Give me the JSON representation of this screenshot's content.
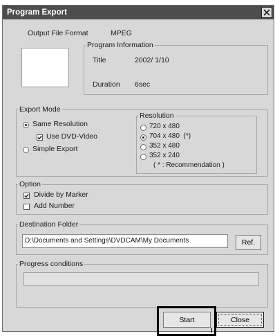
{
  "window": {
    "title": "Program Export"
  },
  "output": {
    "label": "Output File Format",
    "value": "MPEG"
  },
  "program_info": {
    "legend": "Program Information",
    "title_label": "Title",
    "title_value": "2002/ 1/10",
    "duration_label": "Duration",
    "duration_value": "6sec"
  },
  "export_mode": {
    "legend": "Export Mode",
    "same_resolution": "Same Resolution",
    "use_dvd_video": "Use DVD-Video",
    "simple_export": "Simple Export",
    "selected": "Same Resolution",
    "use_dvd_video_checked": true
  },
  "resolution": {
    "legend": "Resolution",
    "options": [
      "720 x 480",
      "704 x 480  (*)",
      "352 x 480",
      "352 x 240"
    ],
    "selected": "704 x 480  (*)",
    "note": "( * : Recommendation )"
  },
  "option": {
    "legend": "Option",
    "divide_by_marker": "Divide by Marker",
    "divide_by_marker_checked": true,
    "add_number": "Add Number",
    "add_number_checked": false
  },
  "destination": {
    "legend": "Destination Folder",
    "path": "D:\\Documents and Settings\\DVDCAM\\My Documents",
    "ref_label": "Ref."
  },
  "progress": {
    "legend": "Progress conditions",
    "value": 0
  },
  "buttons": {
    "start": "Start",
    "close": "Close"
  }
}
